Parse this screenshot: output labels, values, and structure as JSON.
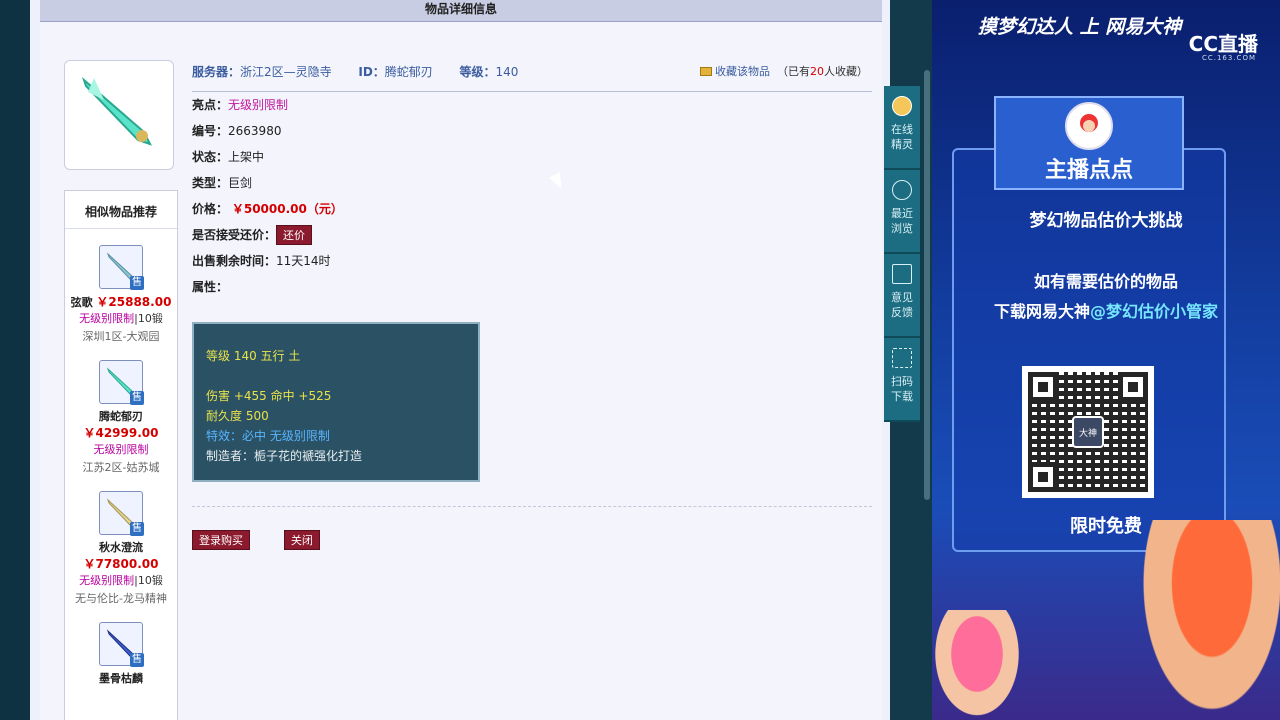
{
  "header": {
    "title": "物品详细信息"
  },
  "info": {
    "server_label": "服务器：",
    "server_value": "浙江2区—灵隐寺",
    "id_label": "ID：",
    "id_value": "腾蛇郁刃",
    "level_label": "等级：",
    "level_value": "140",
    "fav_link": "收藏该物品",
    "fav_prefix": "（已有",
    "fav_count": "20",
    "fav_suffix": "人收藏）",
    "highlight_label": "亮点：",
    "highlight_value": "无级别限制",
    "serial_label": "编号：",
    "serial_value": "2663980",
    "status_label": "状态：",
    "status_value": "上架中",
    "type_label": "类型：",
    "type_value": "巨剑",
    "price_label": "价格：",
    "price_value": "￥50000.00（元）",
    "bargain_label": "是否接受还价：",
    "bargain_button": "还价",
    "remaining_label": "出售剩余时间：",
    "remaining_value": "11天14时",
    "attr_label": "属性："
  },
  "attributes": {
    "line1": "等级 140  五行 土",
    "line2": "伤害 +455 命中 +525",
    "line3": "耐久度 500",
    "line4": "特效：必中 无级别限制",
    "line5": "制造者：栀子花的褫强化打造"
  },
  "actions": {
    "login_buy": "登录购买",
    "close": "关闭"
  },
  "recommend": {
    "title": "相似物品推荐",
    "sell_badge": "售",
    "items": [
      {
        "name": "弦歌",
        "price": "￥25888.00",
        "tag": "无级别限制",
        "ext": "|10锻",
        "server": "深圳1区-大观园"
      },
      {
        "name": "腾蛇郁刃",
        "price": "￥42999.00",
        "tag": "无级别限制",
        "ext": "",
        "server": "江苏2区-姑苏城"
      },
      {
        "name": "秋水澄流",
        "price": "￥77800.00",
        "tag": "无级别限制",
        "ext": "|10锻",
        "server": "无与伦比-龙马精神"
      },
      {
        "name": "墨骨枯麟",
        "price": "",
        "tag": "",
        "ext": "",
        "server": ""
      }
    ]
  },
  "toolbar": [
    {
      "label1": "在线",
      "label2": "精灵"
    },
    {
      "label1": "最近",
      "label2": "浏览"
    },
    {
      "label1": "意见",
      "label2": "反馈"
    },
    {
      "label1": "扫码",
      "label2": "下载"
    }
  ],
  "overlay": {
    "banner": "摸梦幻达人 上 网易大神",
    "logo": "CC直播",
    "logo_url": "CC.163.COM",
    "host_name": "主播点点",
    "challenge": "梦幻物品估价大挑战",
    "line1": "如有需要估价的物品",
    "line2_prefix": "下载网易大神",
    "line2_highlight": "@梦幻估价小管家",
    "qr_center": "大神",
    "free": "限时免费"
  },
  "colors": {
    "accent_maroon": "#8b1a2e",
    "price_red": "#d40000",
    "tag_pink": "#c0189e",
    "toolbar_teal": "#1d6d82"
  }
}
